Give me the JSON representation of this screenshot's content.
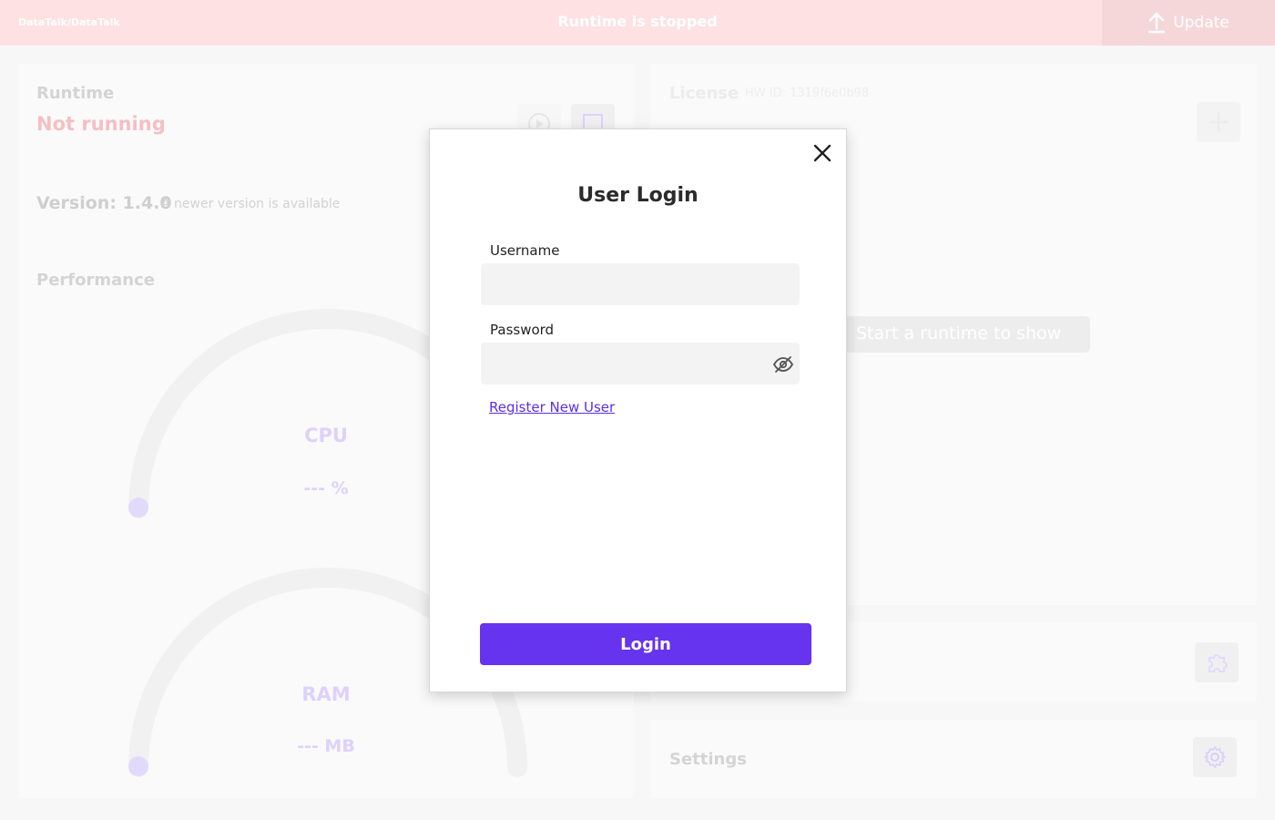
{
  "topbar": {
    "breadcrumb": "DataTalk/DataTalk",
    "status": "Runtime is stopped",
    "update_label": "Update"
  },
  "runtime": {
    "title": "Runtime",
    "state": "Not running",
    "version": "Version: 1.4.0",
    "version_note": "A newer version is available"
  },
  "performance": {
    "title": "Performance",
    "cpu_label": "CPU",
    "cpu_value": "--- %",
    "ram_label": "RAM",
    "ram_value": "--- MB"
  },
  "license": {
    "title": "License",
    "hw_id": "HW ID: 1319f6e0b98",
    "placeholder": "Start a runtime to show"
  },
  "settings": {
    "title": "Settings"
  },
  "login": {
    "title": "User Login",
    "username_label": "Username",
    "username_value": "",
    "password_label": "Password",
    "password_value": "",
    "register_link": "Register New User",
    "login_button": "Login"
  },
  "colors": {
    "accent": "#6633ee",
    "topbar": "#fde1e3",
    "link": "#5b2ee8"
  }
}
